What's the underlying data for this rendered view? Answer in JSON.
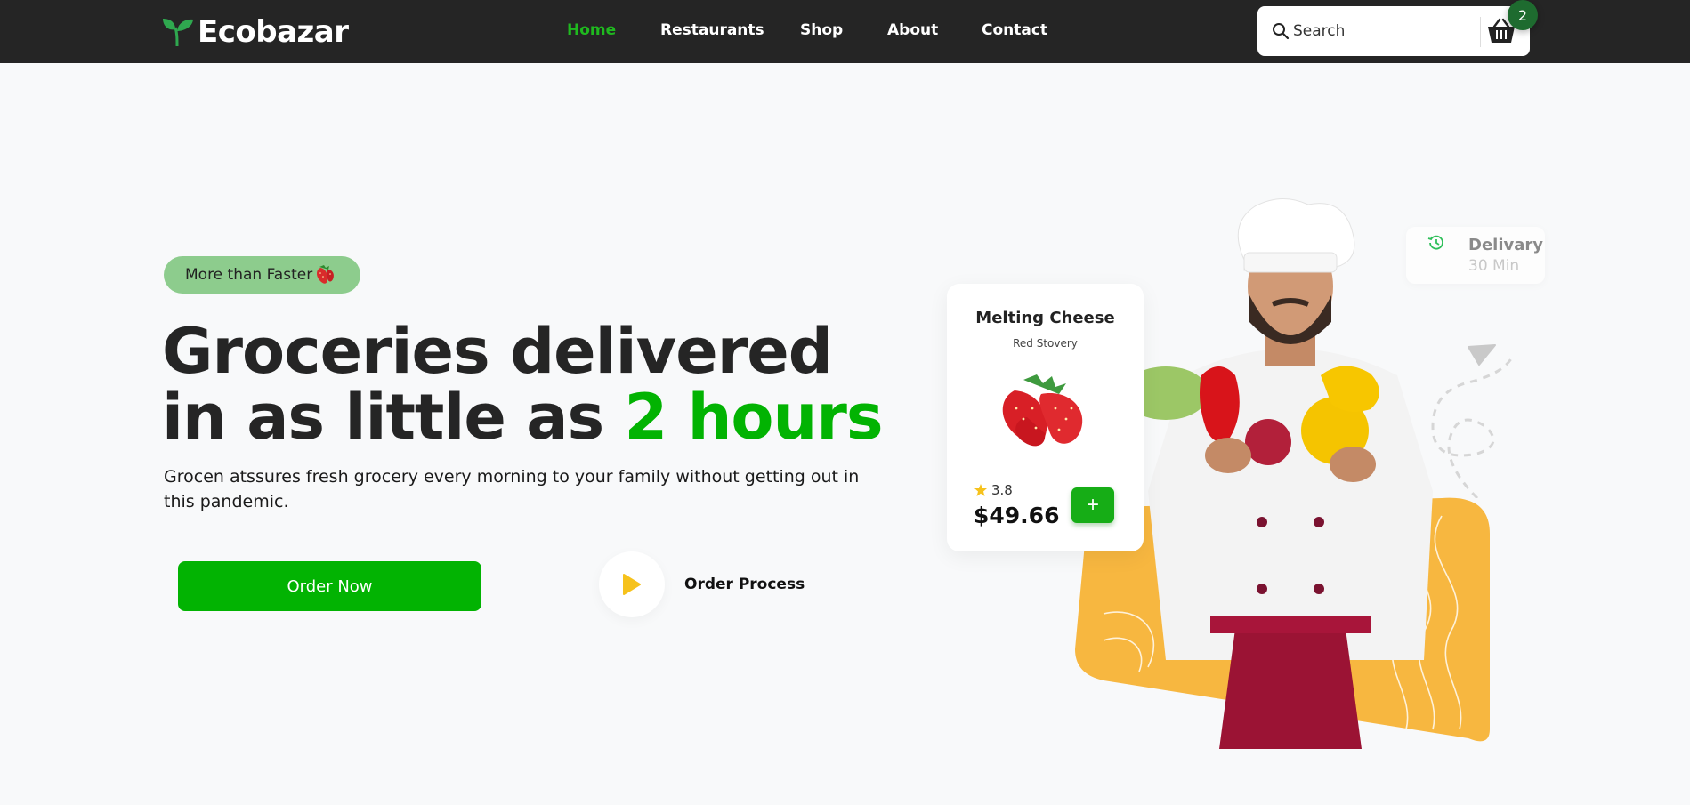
{
  "header": {
    "brand": "Ecobazar",
    "nav": [
      {
        "label": "Home",
        "active": true
      },
      {
        "label": "Restaurants",
        "active": false
      },
      {
        "label": "Shop",
        "active": false
      },
      {
        "label": "About",
        "active": false
      },
      {
        "label": "Contact",
        "active": false
      }
    ],
    "search_placeholder": "Search",
    "cart_count": "2"
  },
  "hero": {
    "pill_label": "More than Faster",
    "heading_line1": "Groceries delivered",
    "heading_line2_prefix": "in as little as ",
    "heading_highlight": "2 hours",
    "description": "Grocen atssures fresh grocery every morning to your family without getting out in this pandemic.",
    "order_button": "Order Now",
    "process_label": "Order Process"
  },
  "product_card": {
    "title": "Melting Cheese",
    "subtitle": "Red Stovery",
    "rating": "3.8",
    "price": "$49.66",
    "add_label": "+"
  },
  "delivery_badge": {
    "title": "Delivary",
    "time": "30 Min"
  },
  "colors": {
    "accent": "#02b302",
    "header_bg": "#252525",
    "pill_bg": "#8dcc8d",
    "orange": "#f7b740",
    "badge": "#1e6b2f"
  },
  "icons": [
    "leaf-logo-icon",
    "search-icon",
    "basket-icon",
    "strawberry-icon",
    "play-icon",
    "star-icon",
    "clock-icon"
  ]
}
